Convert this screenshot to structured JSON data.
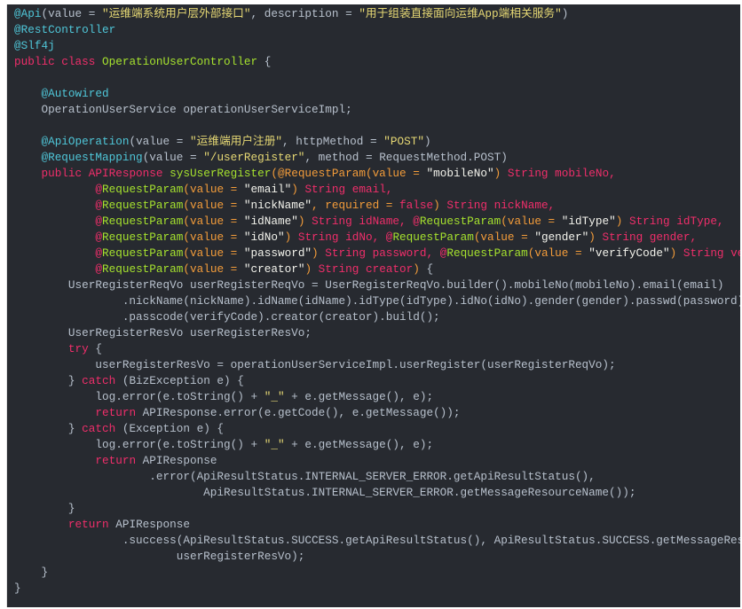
{
  "colors": {
    "background": "#272a30",
    "plain": "#b7c0cc",
    "annotation": "#4fc6d8",
    "string": "#e6d874",
    "keyword": "#ef2e6a",
    "class": "#a6e22e",
    "param": "#f39c3a"
  },
  "code_lines": [
    [
      [
        "a",
        "@Api"
      ],
      [
        "p",
        "(value = "
      ],
      [
        "s",
        "\"运维端系统用户层外部接口\""
      ],
      [
        "p",
        ", description = "
      ],
      [
        "s",
        "\"用于组装直接面向运维App端相关服务\""
      ],
      [
        "p",
        ")"
      ]
    ],
    [
      [
        "a",
        "@RestController"
      ]
    ],
    [
      [
        "a",
        "@Slf4j"
      ]
    ],
    [
      [
        "k",
        "public class "
      ],
      [
        "c",
        "OperationUserController"
      ],
      [
        "p",
        " {"
      ]
    ],
    [],
    [
      [
        "p",
        "    "
      ],
      [
        "a",
        "@Autowired"
      ]
    ],
    [
      [
        "p",
        "    OperationUserService operationUserServiceImpl;"
      ]
    ],
    [],
    [
      [
        "p",
        "    "
      ],
      [
        "a",
        "@ApiOperation"
      ],
      [
        "p",
        "(value = "
      ],
      [
        "s",
        "\"运维端用户注册\""
      ],
      [
        "p",
        ", httpMethod = "
      ],
      [
        "s",
        "\"POST\""
      ],
      [
        "p",
        ")"
      ]
    ],
    [
      [
        "p",
        "    "
      ],
      [
        "a",
        "@RequestMapping"
      ],
      [
        "p",
        "(value = "
      ],
      [
        "s",
        "\"/userRegister\""
      ],
      [
        "p",
        ", method = RequestMethod.POST)"
      ]
    ],
    [
      [
        "p",
        "    "
      ],
      [
        "k",
        "public APIResponse "
      ],
      [
        "c",
        "sysUserRegister"
      ],
      [
        "o",
        "(@RequestParam(value = "
      ],
      [
        "w",
        "\"mobileNo\""
      ],
      [
        "o",
        ")"
      ],
      [
        "k",
        " String mobileNo,"
      ]
    ],
    [
      [
        "p",
        "            "
      ],
      [
        "k",
        "@"
      ],
      [
        "c",
        "RequestParam"
      ],
      [
        "o",
        "(value = "
      ],
      [
        "w",
        "\"email\""
      ],
      [
        "o",
        ")"
      ],
      [
        "k",
        " String email,"
      ]
    ],
    [
      [
        "p",
        "            "
      ],
      [
        "k",
        "@"
      ],
      [
        "c",
        "RequestParam"
      ],
      [
        "o",
        "(value = "
      ],
      [
        "w",
        "\"nickName\""
      ],
      [
        "o",
        ", required = "
      ],
      [
        "k",
        "false"
      ],
      [
        "o",
        ")"
      ],
      [
        "k",
        " String nickName,"
      ]
    ],
    [
      [
        "p",
        "            "
      ],
      [
        "k",
        "@"
      ],
      [
        "c",
        "RequestParam"
      ],
      [
        "o",
        "(value = "
      ],
      [
        "w",
        "\"idName\""
      ],
      [
        "o",
        ")"
      ],
      [
        "k",
        " String idName, @"
      ],
      [
        "c",
        "RequestParam"
      ],
      [
        "o",
        "(value = "
      ],
      [
        "w",
        "\"idType\""
      ],
      [
        "o",
        ")"
      ],
      [
        "k",
        " String idType,"
      ]
    ],
    [
      [
        "p",
        "            "
      ],
      [
        "k",
        "@"
      ],
      [
        "c",
        "RequestParam"
      ],
      [
        "o",
        "(value = "
      ],
      [
        "w",
        "\"idNo\""
      ],
      [
        "o",
        ")"
      ],
      [
        "k",
        " String idNo, @"
      ],
      [
        "c",
        "RequestParam"
      ],
      [
        "o",
        "(value = "
      ],
      [
        "w",
        "\"gender\""
      ],
      [
        "o",
        ")"
      ],
      [
        "k",
        " String gender,"
      ]
    ],
    [
      [
        "p",
        "            "
      ],
      [
        "k",
        "@"
      ],
      [
        "c",
        "RequestParam"
      ],
      [
        "o",
        "(value = "
      ],
      [
        "w",
        "\"password\""
      ],
      [
        "o",
        ")"
      ],
      [
        "k",
        " String password, @"
      ],
      [
        "c",
        "RequestParam"
      ],
      [
        "o",
        "(value = "
      ],
      [
        "w",
        "\"verifyCode\""
      ],
      [
        "o",
        ")"
      ],
      [
        "k",
        " String verifyCode,"
      ]
    ],
    [
      [
        "p",
        "            "
      ],
      [
        "k",
        "@"
      ],
      [
        "c",
        "RequestParam"
      ],
      [
        "o",
        "(value = "
      ],
      [
        "w",
        "\"creator\""
      ],
      [
        "o",
        ")"
      ],
      [
        "k",
        " String creator"
      ],
      [
        "o",
        ")"
      ],
      [
        "p",
        " {"
      ]
    ],
    [
      [
        "p",
        "        UserRegisterReqVo userRegisterReqVo = UserRegisterReqVo.builder().mobileNo(mobileNo).email(email)"
      ]
    ],
    [
      [
        "p",
        "                .nickName(nickName).idName(idName).idType(idType).idNo(idNo).gender(gender).passwd(password)"
      ]
    ],
    [
      [
        "p",
        "                .passcode(verifyCode).creator(creator).build();"
      ]
    ],
    [
      [
        "p",
        "        UserRegisterResVo userRegisterResVo;"
      ]
    ],
    [
      [
        "p",
        "        "
      ],
      [
        "k",
        "try"
      ],
      [
        "p",
        " {"
      ]
    ],
    [
      [
        "p",
        "            userRegisterResVo = operationUserServiceImpl.userRegister(userRegisterReqVo);"
      ]
    ],
    [
      [
        "p",
        "        } "
      ],
      [
        "k",
        "catch"
      ],
      [
        "p",
        " (BizException e) {"
      ]
    ],
    [
      [
        "p",
        "            log.error(e.toString() + "
      ],
      [
        "s",
        "\"_\""
      ],
      [
        "p",
        " + e.getMessage(), e);"
      ]
    ],
    [
      [
        "p",
        "            "
      ],
      [
        "k",
        "return"
      ],
      [
        "p",
        " APIResponse.error(e.getCode(), e.getMessage());"
      ]
    ],
    [
      [
        "p",
        "        } "
      ],
      [
        "k",
        "catch"
      ],
      [
        "p",
        " (Exception e) {"
      ]
    ],
    [
      [
        "p",
        "            log.error(e.toString() + "
      ],
      [
        "s",
        "\"_\""
      ],
      [
        "p",
        " + e.getMessage(), e);"
      ]
    ],
    [
      [
        "p",
        "            "
      ],
      [
        "k",
        "return"
      ],
      [
        "p",
        " APIResponse"
      ]
    ],
    [
      [
        "p",
        "                    .error(ApiResultStatus.INTERNAL_SERVER_ERROR.getApiResultStatus(),"
      ]
    ],
    [
      [
        "p",
        "                            ApiResultStatus.INTERNAL_SERVER_ERROR.getMessageResourceName());"
      ]
    ],
    [
      [
        "p",
        "        }"
      ]
    ],
    [
      [
        "p",
        "        "
      ],
      [
        "k",
        "return"
      ],
      [
        "p",
        " APIResponse"
      ]
    ],
    [
      [
        "p",
        "                .success(ApiResultStatus.SUCCESS.getApiResultStatus(), ApiResultStatus.SUCCESS.getMessageResourceName(),"
      ]
    ],
    [
      [
        "p",
        "                        userRegisterResVo);"
      ]
    ],
    [
      [
        "p",
        "    }"
      ]
    ],
    [
      [
        "p",
        "}"
      ]
    ]
  ]
}
